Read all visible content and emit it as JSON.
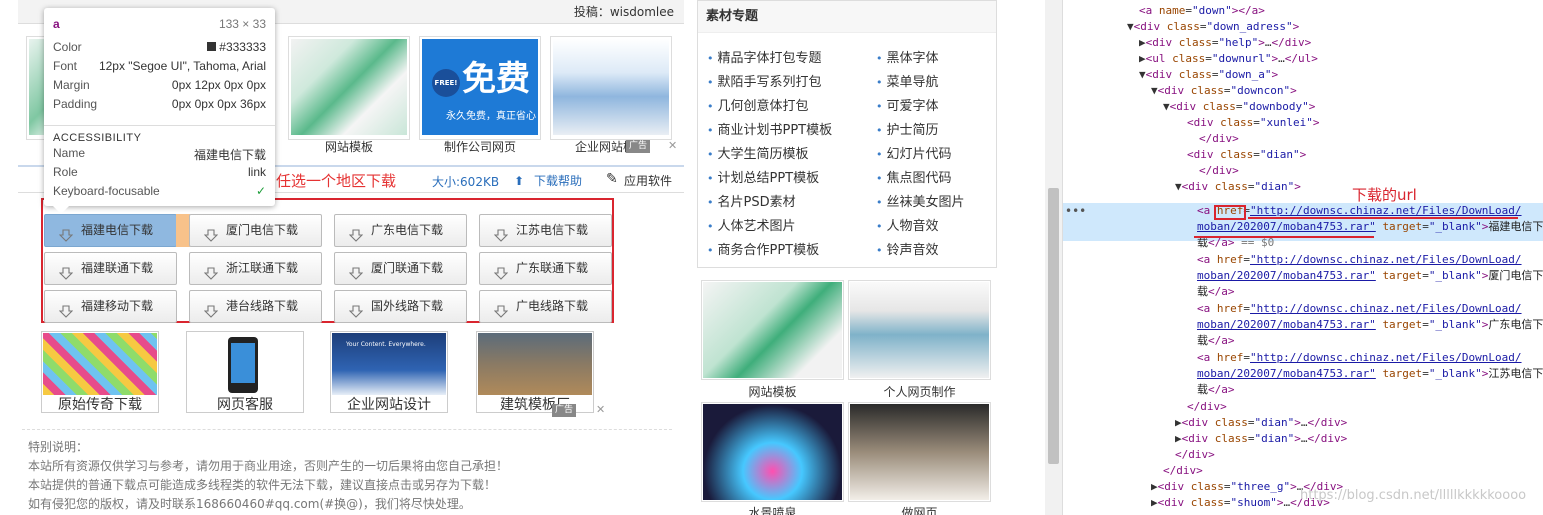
{
  "topbar": {
    "post_label": "投稿：wisdomlee"
  },
  "thumbs": [
    {
      "caption": ""
    },
    {
      "caption": "网站模板"
    },
    {
      "caption": "制作公司网页"
    },
    {
      "caption": "企业网站模板"
    }
  ],
  "ad_label": "广告",
  "free_banner": {
    "big": "免费",
    "badge": "FREE!",
    "sub": "永久免费，真正省心"
  },
  "download_bar": {
    "title": "任选一个地区下载",
    "size": "大小:602KB",
    "help": "下载帮助",
    "soft": "应用软件"
  },
  "download_buttons": [
    [
      "福建电信下载",
      "厦门电信下载",
      "广东电信下载",
      "江苏电信下载"
    ],
    [
      "福建联通下载",
      "浙江联通下载",
      "厦门联通下载",
      "广东联通下载"
    ],
    [
      "福建移动下载",
      "港台线路下载",
      "国外线路下载",
      "广电线路下载"
    ]
  ],
  "bottom_items": [
    {
      "caption": "原始传奇下载"
    },
    {
      "caption": "网页客服"
    },
    {
      "caption": "企业网站设计",
      "banner": "Your Content. Everywhere."
    },
    {
      "caption": "建筑模板厂"
    }
  ],
  "notes": {
    "title": "特别说明：",
    "lines": [
      "本站所有资源仅供学习与参考，请勿用于商业用途，否则产生的一切后果将由您自己承担！",
      "本站提供的普通下载点可能造成多线程类的软件无法下载，建议直接点击或另存为下载！",
      "如有侵犯您的版权，请及时联系168660460#qq.com(#换@)，我们将尽快处理。"
    ]
  },
  "material": {
    "title": "素材专题",
    "left": [
      "精品字体打包专题",
      "默陌手写系列打包",
      "几何创意体打包",
      "商业计划书PPT模板",
      "大学生简历模板",
      "计划总结PPT模板",
      "名片PSD素材",
      "人体艺术图片",
      "商务合作PPT模板"
    ],
    "right": [
      "黑体字体",
      "菜单导航",
      "可爱字体",
      "护士简历",
      "幻灯片代码",
      "焦点图代码",
      "丝袜美女图片",
      "人物音效",
      "铃声音效"
    ]
  },
  "right_thumbs": [
    {
      "caption": "网站模板"
    },
    {
      "caption": "个人网页制作"
    },
    {
      "caption": "水景喷泉"
    },
    {
      "caption": "做网页"
    }
  ],
  "tooltip": {
    "tag": "a",
    "dims": "133 × 33",
    "rows": [
      {
        "k": "Color",
        "v": "#333333"
      },
      {
        "k": "Font",
        "v": "12px \"Segoe UI\", Tahoma, Arial"
      },
      {
        "k": "Margin",
        "v": "0px 12px 0px 0px"
      },
      {
        "k": "Padding",
        "v": "0px 0px 0px 36px"
      }
    ],
    "accessibility": "ACCESSIBILITY",
    "acc_rows": [
      {
        "k": "Name",
        "v": "福建电信下载"
      },
      {
        "k": "Role",
        "v": "link"
      },
      {
        "k": "Keyboard-focusable",
        "v": ""
      }
    ]
  },
  "devtools": {
    "annotation": "下载的url",
    "lines": [
      {
        "indent": 4,
        "arrow": "",
        "html": "a_name_down"
      },
      {
        "indent": 4,
        "arrow": "▼",
        "html": "div_down_adress"
      },
      {
        "indent": 5,
        "arrow": "▶",
        "html": "div_help"
      },
      {
        "indent": 5,
        "arrow": "▶",
        "html": "ul_downurl"
      },
      {
        "indent": 5,
        "arrow": "▼",
        "html": "div_down_a"
      },
      {
        "indent": 6,
        "arrow": "▼",
        "html": "div_downcon"
      },
      {
        "indent": 7,
        "arrow": "▼",
        "html": "div_downbody"
      }
    ],
    "url": "http://downsc.chinaz.net/Files/DownLoad/",
    "url2": "moban/202007/moban4753.rar",
    "links": [
      "福建电信下",
      "厦门电信下",
      "广东电信下",
      "江苏电信下"
    ],
    "tail_char": "载",
    "eq": "== $0",
    "watermark": "https://blog.csdn.net/lllllkkkkkoooo"
  },
  "colors": {
    "accent_red": "#d9252f",
    "link_blue": "#2a6ebb",
    "devtools_tag": "#881280"
  }
}
